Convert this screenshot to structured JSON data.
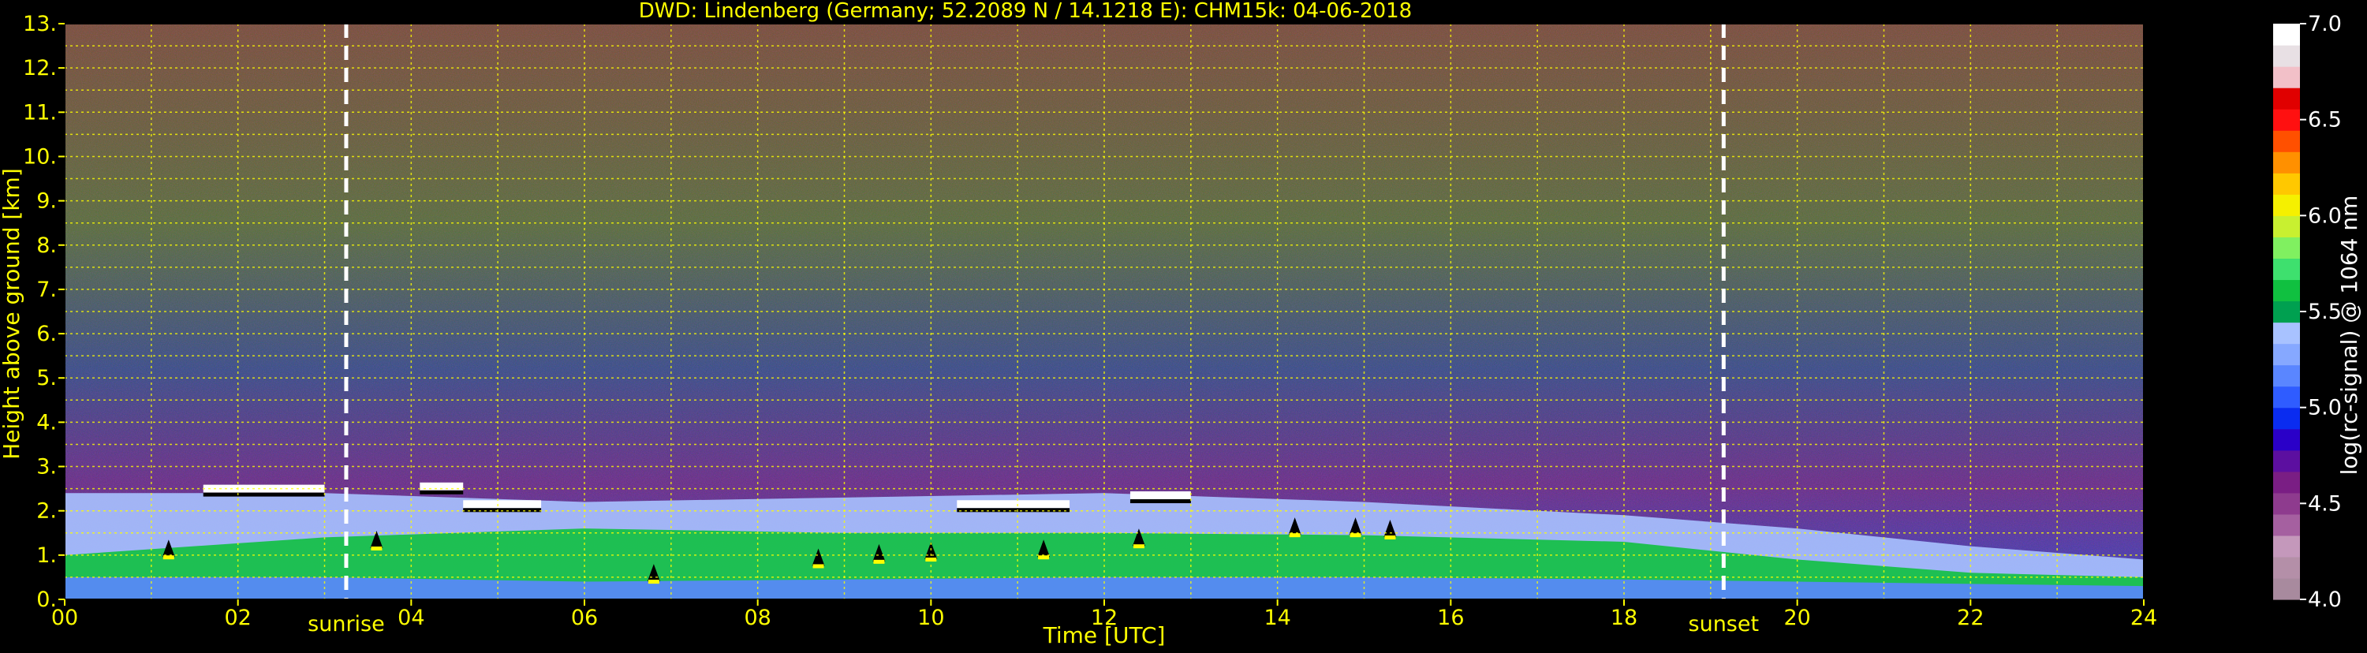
{
  "chart_data": {
    "type": "heatmap",
    "title": "DWD: Lindenberg (Germany; 52.2089 N / 14.1218 E):     CHM15k: 04-06-2018",
    "xlabel": "Time [UTC]",
    "ylabel": "Height above ground [km]",
    "xlim": [
      0,
      24
    ],
    "ylim": [
      0,
      13
    ],
    "grid": true,
    "x_ticks": [
      {
        "value": 0,
        "label": "00"
      },
      {
        "value": 2,
        "label": "02"
      },
      {
        "value": 4,
        "label": "04"
      },
      {
        "value": 6,
        "label": "06"
      },
      {
        "value": 8,
        "label": "08"
      },
      {
        "value": 10,
        "label": "10"
      },
      {
        "value": 12,
        "label": "12"
      },
      {
        "value": 14,
        "label": "14"
      },
      {
        "value": 16,
        "label": "16"
      },
      {
        "value": 18,
        "label": "18"
      },
      {
        "value": 20,
        "label": "20"
      },
      {
        "value": 22,
        "label": "22"
      },
      {
        "value": 24,
        "label": "24"
      }
    ],
    "y_ticks": [
      {
        "value": 0,
        "label": "0."
      },
      {
        "value": 1,
        "label": "1."
      },
      {
        "value": 2,
        "label": "2."
      },
      {
        "value": 3,
        "label": "3."
      },
      {
        "value": 4,
        "label": "4."
      },
      {
        "value": 5,
        "label": "5."
      },
      {
        "value": 6,
        "label": "6."
      },
      {
        "value": 7,
        "label": "7."
      },
      {
        "value": 8,
        "label": "8."
      },
      {
        "value": 9,
        "label": "9."
      },
      {
        "value": 10,
        "label": "10."
      },
      {
        "value": 11,
        "label": "11."
      },
      {
        "value": 12,
        "label": "12."
      },
      {
        "value": 13,
        "label": "13."
      }
    ],
    "annotations": [
      {
        "name": "sunrise",
        "label": "sunrise",
        "x": 3.25
      },
      {
        "name": "sunset",
        "label": "sunset",
        "x": 19.15
      }
    ],
    "colorbar": {
      "label": "log(rc-signal) @ 1064 nm",
      "range": [
        4.0,
        7.0
      ],
      "ticks": [
        {
          "value": 4.0,
          "label": "4.0"
        },
        {
          "value": 4.5,
          "label": "4.5"
        },
        {
          "value": 5.0,
          "label": "5.0"
        },
        {
          "value": 5.5,
          "label": "5.5"
        },
        {
          "value": 6.0,
          "label": "6.0"
        },
        {
          "value": 6.5,
          "label": "6.5"
        },
        {
          "value": 7.0,
          "label": "7.0"
        }
      ],
      "colors": [
        "#a88a9e",
        "#b48fa8",
        "#c498bb",
        "#a560a0",
        "#8e3b8e",
        "#7a1e84",
        "#5c0fa0",
        "#2a00c8",
        "#0a2cf0",
        "#2f5cff",
        "#5a86ff",
        "#86a8ff",
        "#a8c2ff",
        "#00a050",
        "#10c040",
        "#3ee06e",
        "#80f060",
        "#c8f030",
        "#f5f000",
        "#ffc800",
        "#ff9000",
        "#ff5000",
        "#ff1010",
        "#e00000",
        "#f2c0c8",
        "#e8e0e4",
        "#ffffff"
      ]
    },
    "layers": [
      {
        "name": "boundary-layer-base",
        "x": [
          0,
          3,
          6,
          9,
          12,
          15,
          18,
          20,
          22,
          24
        ],
        "top_km": [
          0.5,
          0.5,
          0.4,
          0.45,
          0.5,
          0.5,
          0.45,
          0.4,
          0.35,
          0.3
        ],
        "value": 5.2
      },
      {
        "name": "mixing-layer",
        "x": [
          0,
          3,
          6,
          9,
          12,
          15,
          18,
          20,
          22,
          24
        ],
        "top_km": [
          1.0,
          1.4,
          1.6,
          1.5,
          1.5,
          1.45,
          1.3,
          0.9,
          0.6,
          0.5
        ],
        "value": 5.6
      },
      {
        "name": "aerosol-layer",
        "x": [
          0,
          3,
          6,
          9,
          12,
          15,
          18,
          20,
          22,
          24
        ],
        "top_km": [
          2.4,
          2.4,
          2.2,
          2.3,
          2.4,
          2.2,
          1.9,
          1.6,
          1.2,
          0.9
        ],
        "value": 5.4
      }
    ],
    "cloud_tops": [
      {
        "x_start": 1.6,
        "x_end": 3.0,
        "height_km": 2.5
      },
      {
        "x_start": 4.1,
        "x_end": 4.6,
        "height_km": 2.55
      },
      {
        "x_start": 4.6,
        "x_end": 5.5,
        "height_km": 2.15
      },
      {
        "x_start": 10.3,
        "x_end": 11.6,
        "height_km": 2.15
      },
      {
        "x_start": 12.3,
        "x_end": 13.0,
        "height_km": 2.35
      }
    ],
    "cloud_bases": [
      {
        "x": 1.2,
        "height_km": 1.1
      },
      {
        "x": 3.6,
        "height_km": 1.3
      },
      {
        "x": 6.8,
        "height_km": 0.55
      },
      {
        "x": 8.7,
        "height_km": 0.9
      },
      {
        "x": 9.4,
        "height_km": 1.0
      },
      {
        "x": 10.0,
        "height_km": 1.05
      },
      {
        "x": 11.3,
        "height_km": 1.1
      },
      {
        "x": 12.4,
        "height_km": 1.35
      },
      {
        "x": 14.2,
        "height_km": 1.6
      },
      {
        "x": 14.9,
        "height_km": 1.6
      },
      {
        "x": 15.3,
        "height_km": 1.55
      }
    ]
  }
}
